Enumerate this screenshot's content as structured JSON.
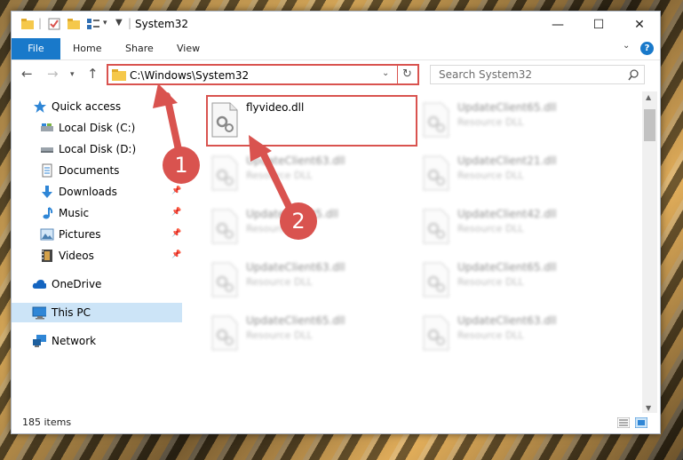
{
  "window": {
    "title": "System32",
    "minimize_glyph": "—",
    "maximize_glyph": "☐",
    "close_glyph": "✕"
  },
  "ribbon": {
    "tabs": [
      "File",
      "Home",
      "Share",
      "View"
    ],
    "help_label": "?"
  },
  "nav": {
    "address": "C:\\Windows\\System32",
    "search_placeholder": "Search System32"
  },
  "sidebar": {
    "items": [
      {
        "label": "Quick access",
        "icon": "star-icon"
      },
      {
        "label": "Local Disk (C:)",
        "icon": "drive-icon"
      },
      {
        "label": "Local Disk (D:)",
        "icon": "drive-icon"
      },
      {
        "label": "Documents",
        "icon": "documents-icon"
      },
      {
        "label": "Downloads",
        "icon": "download-icon"
      },
      {
        "label": "Music",
        "icon": "music-icon"
      },
      {
        "label": "Pictures",
        "icon": "pictures-icon"
      },
      {
        "label": "Videos",
        "icon": "videos-icon"
      },
      {
        "label": "OneDrive",
        "icon": "cloud-icon"
      },
      {
        "label": "This PC",
        "icon": "computer-icon"
      },
      {
        "label": "Network",
        "icon": "network-icon"
      }
    ]
  },
  "files": [
    {
      "name": "flyvideo.dll",
      "type": ""
    },
    {
      "name": "UpdateClient65.dll",
      "type": "Resource DLL"
    },
    {
      "name": "UpdateClient63.dll",
      "type": "Resource DLL"
    },
    {
      "name": "UpdateClient21.dll",
      "type": "Resource DLL"
    },
    {
      "name": "UpdateClient5.dll",
      "type": "Resource DLL"
    },
    {
      "name": "UpdateClient42.dll",
      "type": "Resource DLL"
    },
    {
      "name": "UpdateClient63.dll",
      "type": "Resource DLL"
    },
    {
      "name": "UpdateClient65.dll",
      "type": "Resource DLL"
    },
    {
      "name": "UpdateClient65.dll",
      "type": "Resource DLL"
    },
    {
      "name": "UpdateClient63.dll",
      "type": "Resource DLL"
    }
  ],
  "status": {
    "item_count": "185 items"
  },
  "annotations": {
    "step1": "1",
    "step2": "2"
  },
  "colors": {
    "accent": "#1979ca",
    "highlight": "#d9534f",
    "selected": "#cce4f7"
  }
}
